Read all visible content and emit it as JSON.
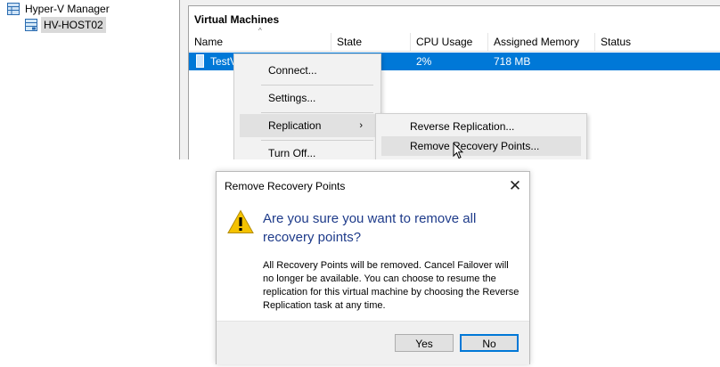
{
  "tree": {
    "root_label": "Hyper-V Manager",
    "host_label": "HV-HOST02"
  },
  "vm_panel": {
    "title": "Virtual Machines",
    "columns": [
      "Name",
      "State",
      "CPU Usage",
      "Assigned Memory",
      "Status"
    ],
    "row": {
      "name": "TestV",
      "state": "",
      "cpu": "2%",
      "memory": "718 MB",
      "status": ""
    }
  },
  "context_menu": {
    "items": [
      "Connect...",
      "Settings...",
      "Replication",
      "Turn Off..."
    ],
    "submenu_arrow": "›"
  },
  "submenu": {
    "items": [
      "Reverse Replication...",
      "Remove Recovery Points..."
    ]
  },
  "dialog": {
    "title": "Remove Recovery Points",
    "close_glyph": "✕",
    "main_instruction": "Are you sure you want to remove all recovery points?",
    "body": "All Recovery Points will be removed. Cancel Failover will no longer be available. You can choose to resume the replication for this virtual machine by choosing the Reverse Replication task at any time.",
    "yes_label": "Yes",
    "no_label": "No"
  },
  "colors": {
    "selection": "#0078d7",
    "main_instruction": "#1e3b8a",
    "warning": "#f4c200"
  },
  "icons": [
    "server-manager-icon",
    "host-icon",
    "vm-icon",
    "warning-icon",
    "mouse-pointer-icon"
  ]
}
